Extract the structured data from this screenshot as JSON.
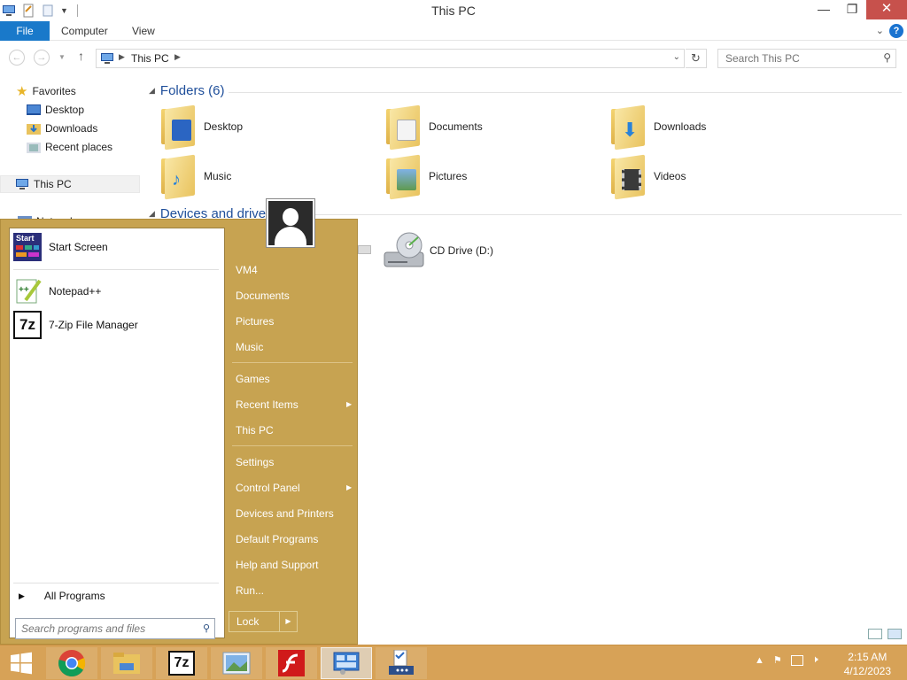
{
  "window": {
    "title": "This PC",
    "minimize": "—",
    "restore": "❐",
    "close": "✕"
  },
  "ribbon": {
    "tabs": [
      "File",
      "Computer",
      "View"
    ],
    "help": "?"
  },
  "address": {
    "crumb": "This PC",
    "search_placeholder": "Search This PC"
  },
  "nav": {
    "favorites": "Favorites",
    "desktop": "Desktop",
    "downloads": "Downloads",
    "recent": "Recent places",
    "thispc": "This PC",
    "network": "Network"
  },
  "content": {
    "folders_header": "Folders (6)",
    "folders": [
      "Desktop",
      "Documents",
      "Downloads",
      "Music",
      "Pictures",
      "Videos"
    ],
    "devices_header": "Devices and drives",
    "drive_label": "CD Drive (D:)"
  },
  "startmenu": {
    "programs": [
      "Start Screen",
      "Notepad++",
      "7-Zip File Manager"
    ],
    "start_tile_text": "Start",
    "all_programs": "All Programs",
    "search_placeholder": "Search programs and files",
    "links": {
      "user": "VM4",
      "documents": "Documents",
      "pictures": "Pictures",
      "music": "Music",
      "games": "Games",
      "recent_items": "Recent Items",
      "this_pc": "This PC",
      "settings": "Settings",
      "control_panel": "Control Panel",
      "devices_printers": "Devices and Printers",
      "default_programs": "Default Programs",
      "help_support": "Help and Support",
      "run": "Run..."
    },
    "lock": "Lock"
  },
  "taskbar": {
    "time": "2:15 AM",
    "date": "4/12/2023",
    "sevenzip_text": "7z"
  },
  "colors": {
    "start_menu_bg": "#c7a351",
    "taskbar_bg": "#d7a257",
    "file_tab": "#1979ca",
    "close_btn": "#c7514c",
    "group_header": "#1e4e9a"
  }
}
